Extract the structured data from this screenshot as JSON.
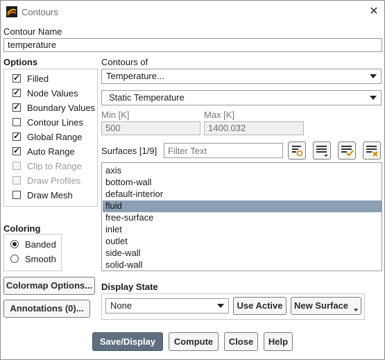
{
  "window": {
    "title": "Contours",
    "close_label": "✕"
  },
  "contour_name": {
    "label": "Contour Name",
    "value": "temperature"
  },
  "options": {
    "title": "Options",
    "items": [
      {
        "label": "Filled",
        "checked": true,
        "disabled": false
      },
      {
        "label": "Node Values",
        "checked": true,
        "disabled": false
      },
      {
        "label": "Boundary Values",
        "checked": true,
        "disabled": false
      },
      {
        "label": "Contour Lines",
        "checked": false,
        "disabled": false
      },
      {
        "label": "Global Range",
        "checked": true,
        "disabled": false
      },
      {
        "label": "Auto Range",
        "checked": true,
        "disabled": false
      },
      {
        "label": "Clip to Range",
        "checked": false,
        "disabled": true
      },
      {
        "label": "Draw Profiles",
        "checked": false,
        "disabled": true
      },
      {
        "label": "Draw Mesh",
        "checked": false,
        "disabled": false
      }
    ]
  },
  "coloring": {
    "title": "Coloring",
    "options": [
      {
        "label": "Banded",
        "selected": true
      },
      {
        "label": "Smooth",
        "selected": false
      }
    ]
  },
  "side_buttons": {
    "colormap": "Colormap Options...",
    "annotations": "Annotations (0)..."
  },
  "contours_of": {
    "label": "Contours of",
    "category": "Temperature...",
    "quantity": "Static Temperature"
  },
  "range": {
    "min_label": "Min [K]",
    "max_label": "Max [K]",
    "min_value": "500",
    "max_value": "1400.032"
  },
  "surfaces": {
    "label": "Surfaces [1/9]",
    "filter_placeholder": "Filter Text",
    "items": [
      "axis",
      "bottom-wall",
      "default-interior",
      "fluid",
      "free-surface",
      "inlet",
      "outlet",
      "side-wall",
      "solid-wall"
    ],
    "selected": "fluid"
  },
  "display_state": {
    "label": "Display State",
    "value": "None",
    "use_active": "Use Active",
    "new_surface": "New Surface"
  },
  "footer": {
    "save_display": "Save/Display",
    "compute": "Compute",
    "close": "Close",
    "help": "Help"
  },
  "colors": {
    "selection": "#8ca0b3",
    "primary_button": "#5f6f7f"
  }
}
